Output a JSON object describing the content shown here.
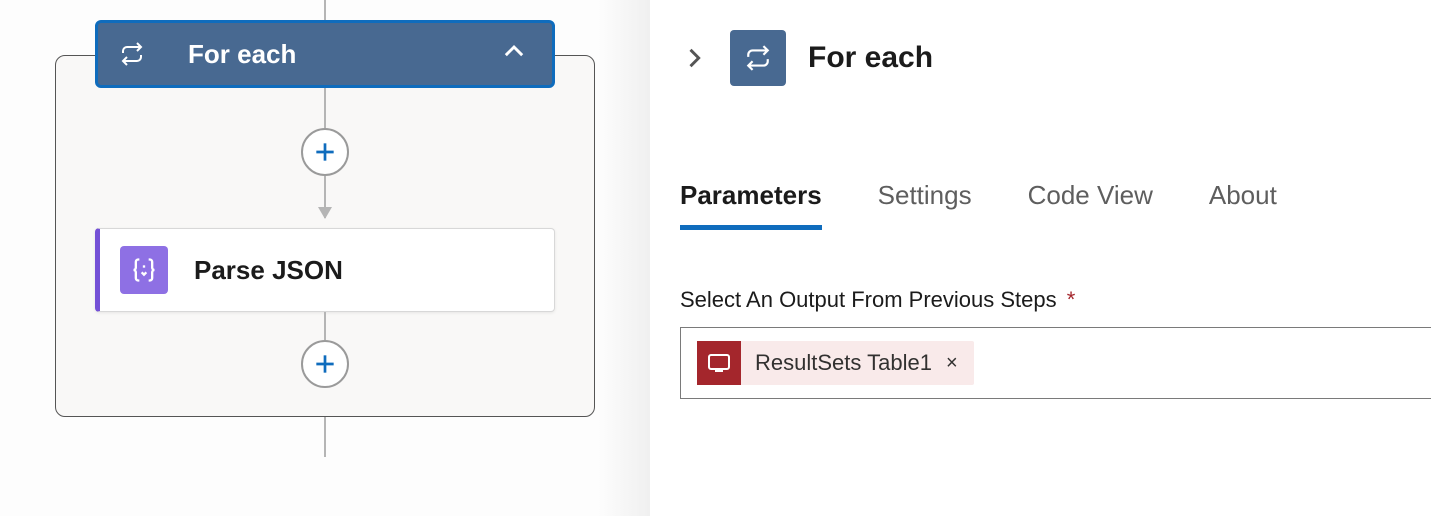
{
  "canvas": {
    "foreach": {
      "title": "For each"
    },
    "inner_card": {
      "title": "Parse JSON"
    }
  },
  "details": {
    "title": "For each",
    "tabs": {
      "parameters": "Parameters",
      "settings": "Settings",
      "code_view": "Code View",
      "about": "About"
    },
    "field": {
      "label": "Select An Output From Previous Steps",
      "required_mark": "*",
      "token": {
        "text": "ResultSets Table1",
        "remove": "×"
      }
    }
  }
}
